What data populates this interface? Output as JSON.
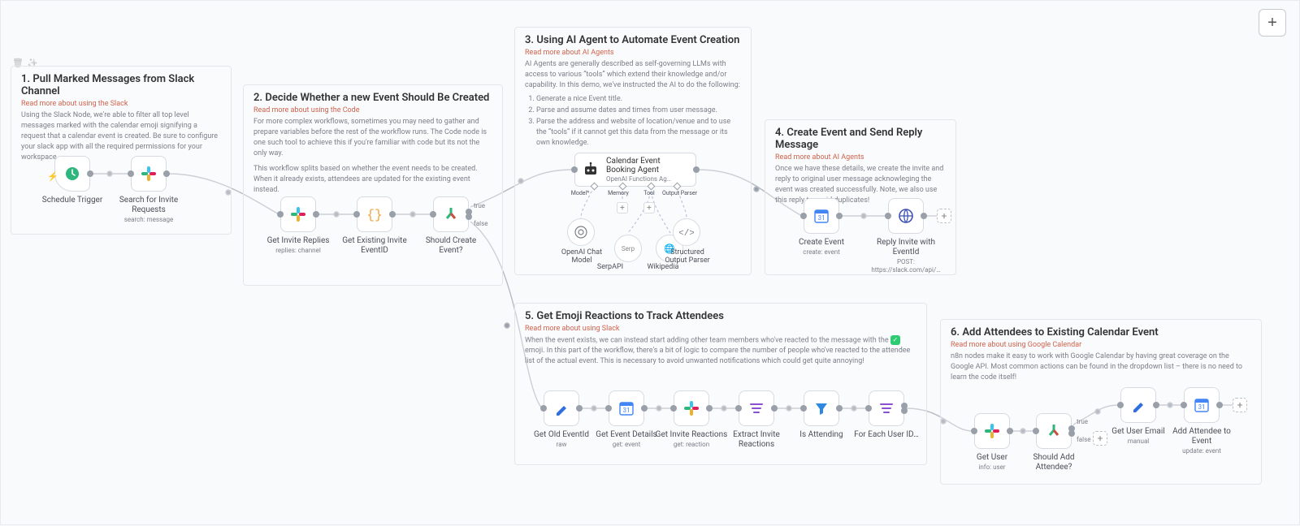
{
  "toolbar": {
    "add": "+"
  },
  "groups": {
    "g1": {
      "title": "1. Pull Marked Messages from Slack Channel",
      "more": "Read more about using the Slack",
      "desc": "Using the Slack Node, we're able to filter all top level messages marked with the calendar emoji signifying a request that a calendar event is created. Be sure to configure your slack app with all the required permissions for your workspace."
    },
    "g2": {
      "title": "2. Decide Whether a new Event Should Be Created",
      "more": "Read more about using the Code",
      "desc1": "For more complex workflows, sometimes you may need to gather and prepare variables before the rest of the workflow runs. The Code node is one such tool to achieve this if you're familiar with code but its not the only way.",
      "desc2": "This workflow splits based on whether the event needs to be created. When it already exists, attendees are updated for the existing event instead."
    },
    "g3": {
      "title": "3. Using AI Agent to Automate Event Creation",
      "more": "Read more about AI Agents",
      "desc_intro": "AI Agents are generally described as self-governing LLMs with access to various “tools” which extend their knowledge and/or capability. In this demo, we've instructed the AI to do the following:",
      "steps": [
        "Generate a nice Event title.",
        "Parse and assume dates and times from user message.",
        "Parse the address and website of location/venue and to use the “tools” if it cannot get this data from the message or its own knowledge."
      ]
    },
    "g4": {
      "title": "4. Create Event and Send Reply Message",
      "more": "Read more about AI Agents",
      "desc": "Once we have these details, we create the invite and reply to original user message acknowleging the event was created successfully. Note, we also use this reply to avoid duplicates!"
    },
    "g5": {
      "title": "5. Get Emoji Reactions to Track Attendees",
      "more": "Read more about using Slack",
      "desc_a": "When the event exists, we can instead start adding other team members who've reacted to the message with the ",
      "desc_b": " emoji. In this part of the workflow, there's a bit of logic to compare the number of people who've reacted to the attendee list of the actual event. This is necessary to avoid unwanted notifications which could get quite annoying!"
    },
    "g6": {
      "title": "6. Add Attendees to Existing Calendar Event",
      "more": "Read more about using Google Calendar",
      "desc": "n8n nodes make it easy to work with Google Calendar by having great coverage on the Google API. Most common actions can be found in the dropdown list – there is no need to learn the code itself!"
    }
  },
  "nodes": {
    "schedule": {
      "label": "Schedule Trigger"
    },
    "search": {
      "label": "Search for Invite Requests",
      "sub": "search: message"
    },
    "getReplies": {
      "label": "Get Invite Replies",
      "sub": "replies: channel"
    },
    "getExisting": {
      "label": "Get Existing Invite EventID"
    },
    "shouldCreate": {
      "label": "Should Create Event?",
      "true": "true",
      "false": "false"
    },
    "agent": {
      "label": "Calendar Event Booking Agent",
      "sub": "OpenAI Functions Ag…"
    },
    "sub_model": {
      "label": "OpenAI Chat Model",
      "h": "Model*"
    },
    "sub_memory": {
      "h": "Memory"
    },
    "sub_tool": {
      "h": "Tool"
    },
    "sub_parser": {
      "label": "Structured Output Parser",
      "h": "Output Parser"
    },
    "serp": {
      "label": "SerpAPI"
    },
    "wiki": {
      "label": "Wikipedia"
    },
    "createEvent": {
      "label": "Create Event",
      "sub": "create: event"
    },
    "reply": {
      "label": "Reply Invite with EventId",
      "sub": "POST: https://slack.com/api/…"
    },
    "oldId": {
      "label": "Get Old EventId",
      "sub": "raw"
    },
    "details": {
      "label": "Get Event Details",
      "sub": "get: event"
    },
    "reactions": {
      "label": "Get Invite Reactions",
      "sub": "get: reaction"
    },
    "extract": {
      "label": "Extract Invite Reactions"
    },
    "isAttending": {
      "label": "Is Attending"
    },
    "forEach": {
      "label": "For Each User ID…"
    },
    "getUser": {
      "label": "Get User",
      "sub": "info: user"
    },
    "shouldAdd": {
      "label": "Should Add Attendee?",
      "true": "true",
      "false": "false"
    },
    "email": {
      "label": "Get User Email",
      "sub": "manual"
    },
    "addAttendee": {
      "label": "Add Attendee to Event",
      "sub": "update: event"
    }
  }
}
